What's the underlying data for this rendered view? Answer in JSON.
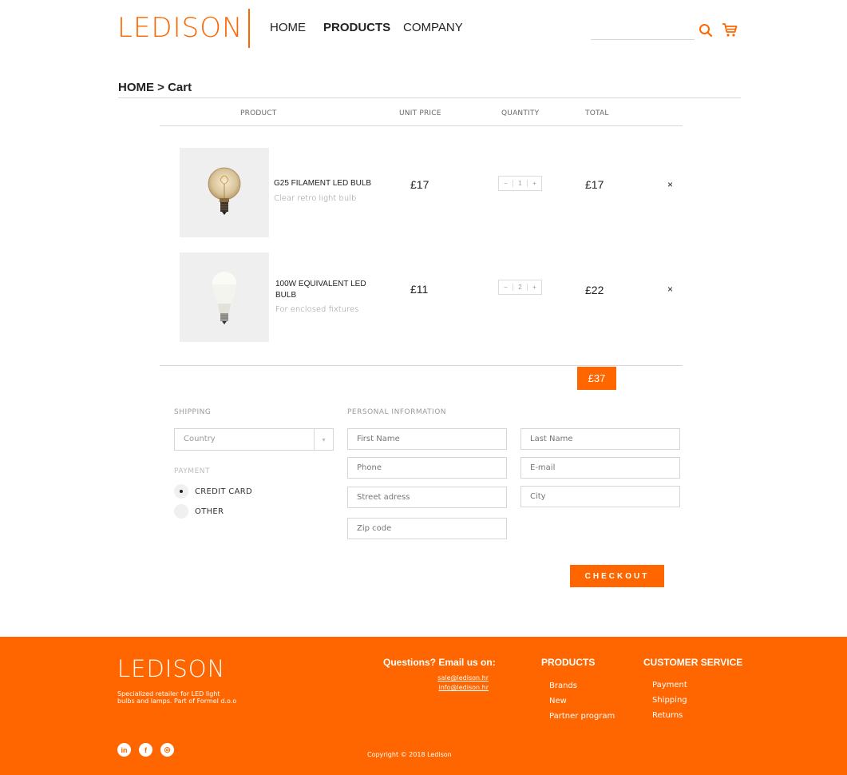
{
  "brand": {
    "logo": "LEDISON",
    "accent_color": "#ff6600"
  },
  "nav": {
    "items": [
      {
        "label": "HOME"
      },
      {
        "label": "PRODUCTS"
      },
      {
        "label": "COMPANY"
      }
    ]
  },
  "search": {
    "value": "",
    "placeholder": "",
    "icon": "search-icon"
  },
  "cart_icon": "cart-icon",
  "breadcrumb": "HOME > Cart",
  "table": {
    "headers": {
      "product": "PRODUCT",
      "unit_price": "UNIT PRICE",
      "quantity": "QUANTITY",
      "total": "TOTAL"
    },
    "rows": [
      {
        "name": "G25 FILAMENT LED BULB",
        "description": "Clear retro light bulb",
        "unit_price": "£17",
        "qty_minus": "−",
        "quantity": "1",
        "qty_plus": "+",
        "total": "£17",
        "remove": "×"
      },
      {
        "name": "100W EQUIVALENT LED BULB",
        "description": "For enclosed fixtures",
        "unit_price": "£11",
        "qty_minus": "−",
        "quantity": "2",
        "qty_plus": "+",
        "total": "£22",
        "remove": "×"
      }
    ],
    "grand_total": "£37"
  },
  "shipping": {
    "label": "SHIPPING",
    "country": {
      "value": "Country",
      "arrow": "▾"
    }
  },
  "payment": {
    "label": "PAYMENT",
    "options": [
      {
        "label": "CREDIT CARD",
        "selected": true
      },
      {
        "label": "OTHER",
        "selected": false
      }
    ]
  },
  "personal": {
    "label": "PERSONAL INFORMATION",
    "first_name": "First Name",
    "last_name": "Last Name",
    "phone": "Phone",
    "email": "E-mail",
    "street": "Street adress",
    "city": "City",
    "zip": "Zip code"
  },
  "checkout_label": "CHECKOUT",
  "footer": {
    "logo": "LEDISON",
    "tagline": "Specialized retailer for LED light bulbs and lamps. Part of Formel d.o.o",
    "contact_heading": "Questions? Email us on:",
    "emails": [
      "sale@ledison.hr",
      "info@ledison.hr"
    ],
    "products_heading": "PRODUCTS",
    "products_links": [
      "Brands",
      "New",
      "Partner program"
    ],
    "service_heading": "CUSTOMER SERVICE",
    "service_links": [
      "Payment",
      "Shipping",
      "Returns"
    ],
    "social": [
      {
        "icon": "linkedin-icon",
        "glyph": "in"
      },
      {
        "icon": "facebook-icon",
        "glyph": "f"
      },
      {
        "icon": "instagram-icon",
        "glyph": "◎"
      }
    ],
    "copyright": "Copyright © 2018 Ledison"
  }
}
